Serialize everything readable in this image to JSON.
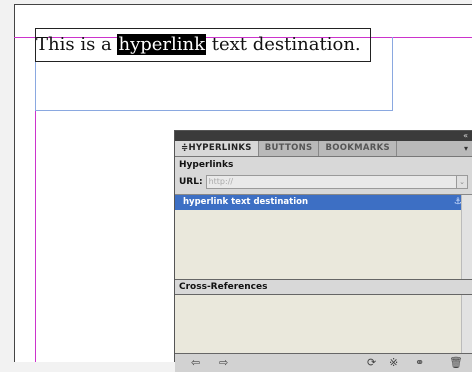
{
  "document": {
    "text_before": "This is a ",
    "highlighted_text": "hyperlink",
    "text_after": " text destination."
  },
  "panel": {
    "tabs": [
      {
        "label": "HYPERLINKS",
        "active": true
      },
      {
        "label": "BUTTONS",
        "active": false
      },
      {
        "label": "BOOKMARKS",
        "active": false
      }
    ],
    "tab_prefix": "≑",
    "collapse_icon": "«",
    "menu_icon": "▾",
    "hyperlinks_title": "Hyperlinks",
    "url_label": "URL:",
    "url_placeholder": "http://",
    "url_dropdown_icon": "⌄",
    "list_items": [
      "hyperlink text destination"
    ],
    "anchor_icon": "⚓",
    "cross_references_title": "Cross-References",
    "bottom_icons": {
      "prev": "⇦",
      "next": "⇨",
      "refresh": "⟳",
      "new_hyperlink": "※",
      "new_link": "⚭",
      "delete": "🗑"
    }
  }
}
